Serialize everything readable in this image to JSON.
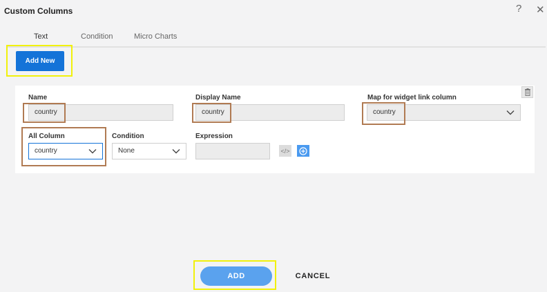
{
  "header": {
    "title": "Custom Columns",
    "help_icon": "?",
    "close_icon": "✕"
  },
  "tabs": [
    {
      "label": "Text",
      "active": true
    },
    {
      "label": "Condition",
      "active": false
    },
    {
      "label": "Micro Charts",
      "active": false
    }
  ],
  "toolbar": {
    "add_new_label": "Add New"
  },
  "form": {
    "name_label": "Name",
    "name_value": "country",
    "display_name_label": "Display Name",
    "display_name_value": "country",
    "map_label": "Map for widget link column",
    "map_value": "country",
    "all_column_label": "All Column",
    "all_column_value": "country",
    "condition_label": "Condition",
    "condition_value": "None",
    "expression_label": "Expression",
    "expression_value": "",
    "code_icon_glyph": "</>"
  },
  "footer": {
    "add_label": "ADD",
    "cancel_label": "CANCEL"
  },
  "colors": {
    "primary": "#1473d8",
    "add_button": "#5aa2ee",
    "highlight_yellow": "#f1f10a",
    "highlight_brown": "#b07a52"
  }
}
